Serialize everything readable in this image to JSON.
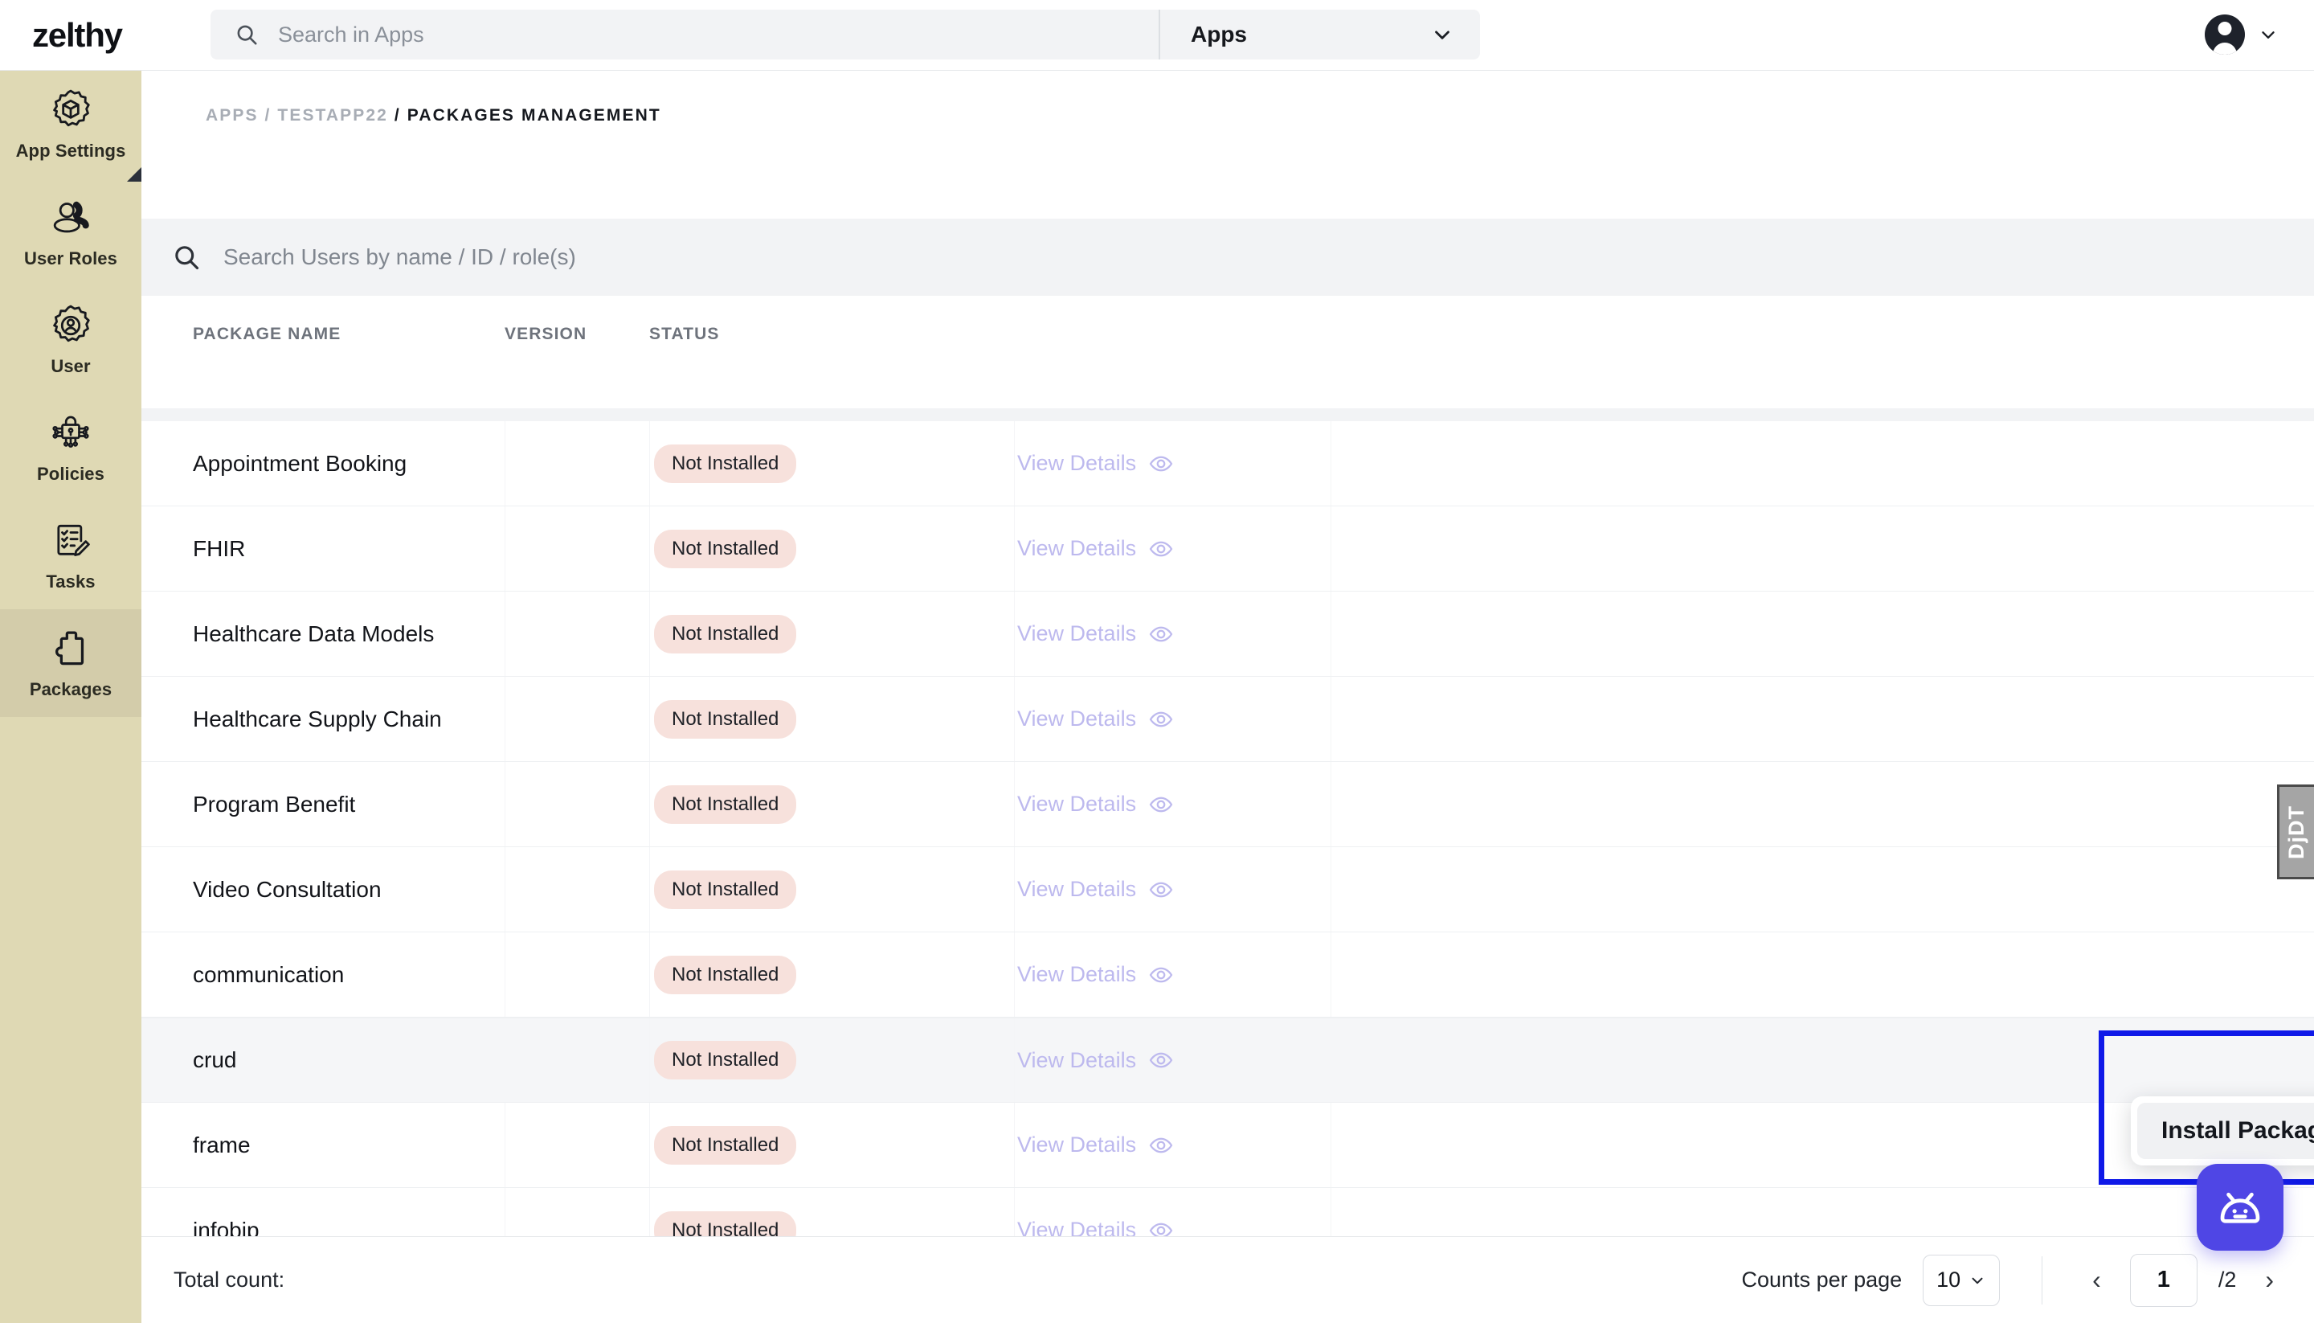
{
  "brand": {
    "logo": "zelthy",
    "accent": "#4f46e5",
    "sidebar_bg": "#dfd9b4",
    "badge_bg": "#f7e1dc",
    "highlight_border": "#0f19e8"
  },
  "topbar": {
    "search": {
      "placeholder": "Search in Apps",
      "value": "",
      "icon": "search-icon"
    },
    "app_selector": {
      "label": "Apps",
      "icon": "chevron-down-icon"
    },
    "account": {
      "icon": "user-avatar-icon",
      "chevron": "chevron-down-icon"
    }
  },
  "sidebar": {
    "items": [
      {
        "label": "App Settings",
        "icon": "gear-cube-icon",
        "active": false,
        "marker": true
      },
      {
        "label": "User Roles",
        "icon": "users-icon",
        "active": false,
        "marker": false
      },
      {
        "label": "User",
        "icon": "gear-user-icon",
        "active": false,
        "marker": false
      },
      {
        "label": "Policies",
        "icon": "lock-network-icon",
        "active": false,
        "marker": false
      },
      {
        "label": "Tasks",
        "icon": "checklist-pencil-icon",
        "active": false,
        "marker": false
      },
      {
        "label": "Packages",
        "icon": "puzzle-piece-icon",
        "active": true,
        "marker": false
      }
    ]
  },
  "breadcrumb": {
    "root": "APPS",
    "sep1": "/",
    "app": "TESTAPP22",
    "sep2": "/",
    "current": "PACKAGES MANAGEMENT"
  },
  "search": {
    "placeholder": "Search Users by name / ID / role(s)",
    "value": "",
    "icon": "search-icon"
  },
  "table": {
    "columns": [
      "PACKAGE NAME",
      "VERSION",
      "STATUS"
    ],
    "action_label": "View Details",
    "action_icon": "eye-icon",
    "rows": [
      {
        "name": "Appointment Booking",
        "version": "",
        "status": "Not Installed",
        "hover": false
      },
      {
        "name": "FHIR",
        "version": "",
        "status": "Not Installed",
        "hover": false
      },
      {
        "name": "Healthcare Data Models",
        "version": "",
        "status": "Not Installed",
        "hover": false
      },
      {
        "name": "Healthcare Supply Chain",
        "version": "",
        "status": "Not Installed",
        "hover": false
      },
      {
        "name": "Program Benefit",
        "version": "",
        "status": "Not Installed",
        "hover": false
      },
      {
        "name": "Video Consultation",
        "version": "",
        "status": "Not Installed",
        "hover": false
      },
      {
        "name": "communication",
        "version": "",
        "status": "Not Installed",
        "hover": false
      },
      {
        "name": "crud",
        "version": "",
        "status": "Not Installed",
        "hover": true
      },
      {
        "name": "frame",
        "version": "",
        "status": "Not Installed",
        "hover": false
      },
      {
        "name": "infobip",
        "version": "",
        "status": "Not Installed",
        "hover": false
      }
    ]
  },
  "row_menu": {
    "trigger_icon": "kebab-menu-icon",
    "items": [
      "Install Package"
    ]
  },
  "footer": {
    "total_count_label": "Total count:",
    "total_count_value": "",
    "counts_per_page_label": "Counts per page",
    "counts_per_page_value": "10",
    "prev_icon": "chevron-left-icon",
    "next_icon": "chevron-right-icon",
    "page_current": "1",
    "page_total": "/2"
  },
  "widgets": {
    "debug_toolbar": {
      "label": "DjDT"
    },
    "chat_button": {
      "icon": "robot-icon"
    }
  }
}
